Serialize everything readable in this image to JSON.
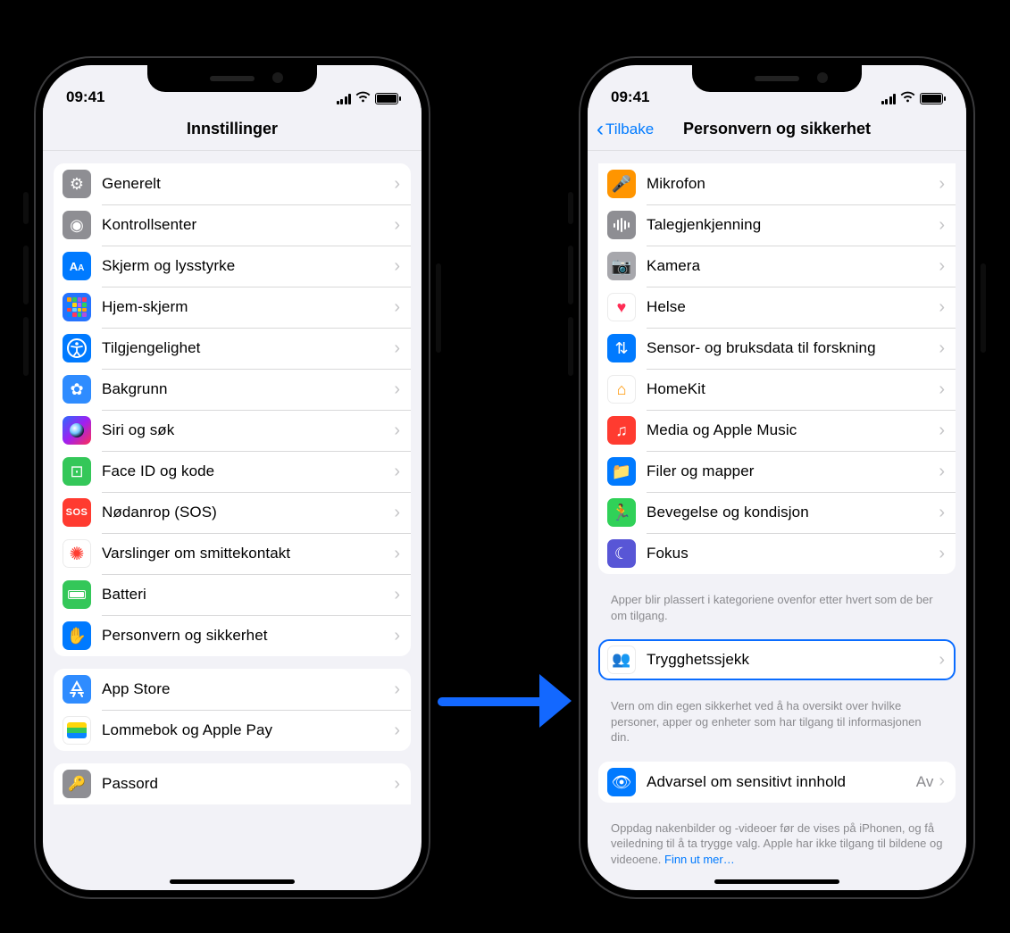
{
  "status": {
    "time": "09:41"
  },
  "arrow": true,
  "left": {
    "title": "Innstillinger",
    "groups": [
      {
        "highlightIndex": 12,
        "rows": [
          {
            "label": "Generelt",
            "iconName": "gear-icon",
            "iconClass": "c-gray"
          },
          {
            "label": "Kontrollsenter",
            "iconName": "toggles-icon",
            "iconClass": "c-gray"
          },
          {
            "label": "Skjerm og lysstyrke",
            "iconName": "text-size-icon",
            "iconClass": "c-blue"
          },
          {
            "label": "Hjem-skjerm",
            "iconName": "apps-grid-icon",
            "iconClass": "c-apps"
          },
          {
            "label": "Tilgjengelighet",
            "iconName": "accessibility-icon",
            "iconClass": "c-blue"
          },
          {
            "label": "Bakgrunn",
            "iconName": "flower-icon",
            "iconClass": "c-sky"
          },
          {
            "label": "Siri og søk",
            "iconName": "siri-icon",
            "iconClass": "c-black"
          },
          {
            "label": "Face ID og kode",
            "iconName": "faceid-icon",
            "iconClass": "c-green"
          },
          {
            "label": "Nødanrop (SOS)",
            "iconName": "sos-icon",
            "iconClass": "c-red"
          },
          {
            "label": "Varslinger om smittekontakt",
            "iconName": "exposure-icon",
            "iconClass": "c-white"
          },
          {
            "label": "Batteri",
            "iconName": "battery-icon",
            "iconClass": "c-green"
          },
          {
            "label": "Personvern og sikkerhet",
            "iconName": "hand-icon",
            "iconClass": "c-blue"
          }
        ]
      },
      {
        "rows": [
          {
            "label": "App Store",
            "iconName": "appstore-icon",
            "iconClass": "c-sky"
          },
          {
            "label": "Lommebok og Apple Pay",
            "iconName": "wallet-icon",
            "iconClass": "c-white"
          }
        ]
      },
      {
        "partial": true,
        "rows": [
          {
            "label": "Passord",
            "iconName": "key-icon",
            "iconClass": "c-gray"
          }
        ]
      }
    ]
  },
  "right": {
    "back": "Tilbake",
    "title": "Personvern og sikkerhet",
    "sections": [
      {
        "continuedTop": true,
        "rows": [
          {
            "label": "Mikrofon",
            "iconName": "mic-icon",
            "iconClass": "c-orange"
          },
          {
            "label": "Talegjenkjenning",
            "iconName": "wave-icon",
            "iconClass": "c-gray"
          },
          {
            "label": "Kamera",
            "iconName": "camera-icon",
            "iconClass": "c-gray2"
          },
          {
            "label": "Helse",
            "iconName": "heart-icon",
            "iconClass": "c-white"
          },
          {
            "label": "Sensor- og bruksdata til forskning",
            "iconName": "data-icon",
            "iconClass": "c-blue"
          },
          {
            "label": "HomeKit",
            "iconName": "home-icon",
            "iconClass": "c-white"
          },
          {
            "label": "Media og Apple Music",
            "iconName": "music-icon",
            "iconClass": "c-red"
          },
          {
            "label": "Filer og mapper",
            "iconName": "folder-icon",
            "iconClass": "c-blue"
          },
          {
            "label": "Bevegelse og kondisjon",
            "iconName": "runner-icon",
            "iconClass": "c-green2"
          },
          {
            "label": "Fokus",
            "iconName": "moon-icon",
            "iconClass": "c-purple"
          }
        ],
        "footer": "Apper blir plassert i kategoriene ovenfor etter hvert som de ber om tilgang."
      },
      {
        "highlightIndex": 0,
        "rows": [
          {
            "label": "Trygghetssjekk",
            "iconName": "person-check-icon",
            "iconClass": "c-white"
          }
        ],
        "footer": "Vern om din egen sikkerhet ved å ha oversikt over hvilke personer, apper og enheter som har tilgang til informasjonen din."
      },
      {
        "rows": [
          {
            "label": "Advarsel om sensitivt innhold",
            "value": "Av",
            "iconName": "eye-warn-icon",
            "iconClass": "c-blue"
          }
        ],
        "footer": "Oppdag nakenbilder og -videoer før de vises på iPhonen, og få veiledning til å ta trygge valg. Apple har ikke tilgang til bildene og videoene. ",
        "footerLink": "Finn ut mer…"
      }
    ]
  }
}
